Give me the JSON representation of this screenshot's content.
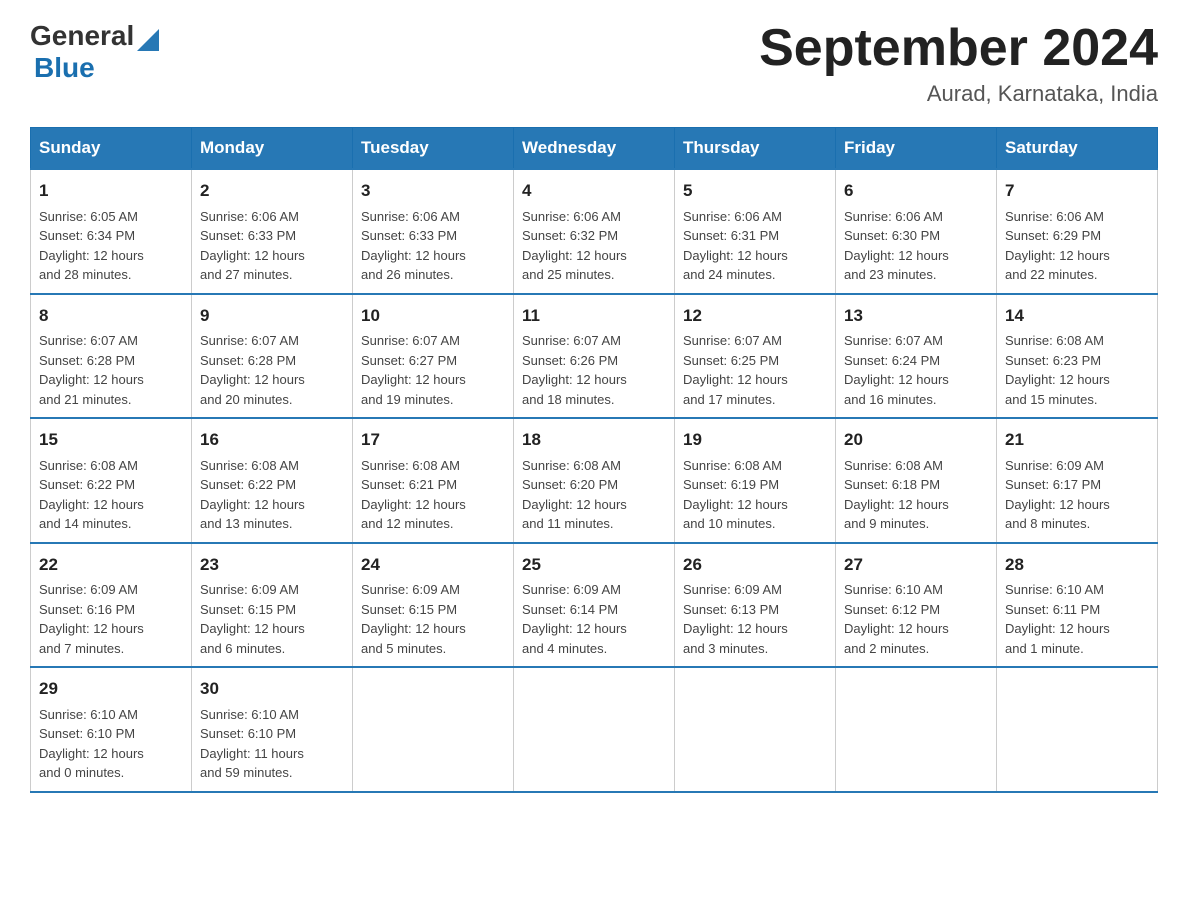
{
  "header": {
    "logo_general": "General",
    "logo_blue": "Blue",
    "month_title": "September 2024",
    "location": "Aurad, Karnataka, India"
  },
  "weekdays": [
    "Sunday",
    "Monday",
    "Tuesday",
    "Wednesday",
    "Thursday",
    "Friday",
    "Saturday"
  ],
  "weeks": [
    [
      {
        "day": "1",
        "sunrise": "6:05 AM",
        "sunset": "6:34 PM",
        "daylight": "12 hours and 28 minutes."
      },
      {
        "day": "2",
        "sunrise": "6:06 AM",
        "sunset": "6:33 PM",
        "daylight": "12 hours and 27 minutes."
      },
      {
        "day": "3",
        "sunrise": "6:06 AM",
        "sunset": "6:33 PM",
        "daylight": "12 hours and 26 minutes."
      },
      {
        "day": "4",
        "sunrise": "6:06 AM",
        "sunset": "6:32 PM",
        "daylight": "12 hours and 25 minutes."
      },
      {
        "day": "5",
        "sunrise": "6:06 AM",
        "sunset": "6:31 PM",
        "daylight": "12 hours and 24 minutes."
      },
      {
        "day": "6",
        "sunrise": "6:06 AM",
        "sunset": "6:30 PM",
        "daylight": "12 hours and 23 minutes."
      },
      {
        "day": "7",
        "sunrise": "6:06 AM",
        "sunset": "6:29 PM",
        "daylight": "12 hours and 22 minutes."
      }
    ],
    [
      {
        "day": "8",
        "sunrise": "6:07 AM",
        "sunset": "6:28 PM",
        "daylight": "12 hours and 21 minutes."
      },
      {
        "day": "9",
        "sunrise": "6:07 AM",
        "sunset": "6:28 PM",
        "daylight": "12 hours and 20 minutes."
      },
      {
        "day": "10",
        "sunrise": "6:07 AM",
        "sunset": "6:27 PM",
        "daylight": "12 hours and 19 minutes."
      },
      {
        "day": "11",
        "sunrise": "6:07 AM",
        "sunset": "6:26 PM",
        "daylight": "12 hours and 18 minutes."
      },
      {
        "day": "12",
        "sunrise": "6:07 AM",
        "sunset": "6:25 PM",
        "daylight": "12 hours and 17 minutes."
      },
      {
        "day": "13",
        "sunrise": "6:07 AM",
        "sunset": "6:24 PM",
        "daylight": "12 hours and 16 minutes."
      },
      {
        "day": "14",
        "sunrise": "6:08 AM",
        "sunset": "6:23 PM",
        "daylight": "12 hours and 15 minutes."
      }
    ],
    [
      {
        "day": "15",
        "sunrise": "6:08 AM",
        "sunset": "6:22 PM",
        "daylight": "12 hours and 14 minutes."
      },
      {
        "day": "16",
        "sunrise": "6:08 AM",
        "sunset": "6:22 PM",
        "daylight": "12 hours and 13 minutes."
      },
      {
        "day": "17",
        "sunrise": "6:08 AM",
        "sunset": "6:21 PM",
        "daylight": "12 hours and 12 minutes."
      },
      {
        "day": "18",
        "sunrise": "6:08 AM",
        "sunset": "6:20 PM",
        "daylight": "12 hours and 11 minutes."
      },
      {
        "day": "19",
        "sunrise": "6:08 AM",
        "sunset": "6:19 PM",
        "daylight": "12 hours and 10 minutes."
      },
      {
        "day": "20",
        "sunrise": "6:08 AM",
        "sunset": "6:18 PM",
        "daylight": "12 hours and 9 minutes."
      },
      {
        "day": "21",
        "sunrise": "6:09 AM",
        "sunset": "6:17 PM",
        "daylight": "12 hours and 8 minutes."
      }
    ],
    [
      {
        "day": "22",
        "sunrise": "6:09 AM",
        "sunset": "6:16 PM",
        "daylight": "12 hours and 7 minutes."
      },
      {
        "day": "23",
        "sunrise": "6:09 AM",
        "sunset": "6:15 PM",
        "daylight": "12 hours and 6 minutes."
      },
      {
        "day": "24",
        "sunrise": "6:09 AM",
        "sunset": "6:15 PM",
        "daylight": "12 hours and 5 minutes."
      },
      {
        "day": "25",
        "sunrise": "6:09 AM",
        "sunset": "6:14 PM",
        "daylight": "12 hours and 4 minutes."
      },
      {
        "day": "26",
        "sunrise": "6:09 AM",
        "sunset": "6:13 PM",
        "daylight": "12 hours and 3 minutes."
      },
      {
        "day": "27",
        "sunrise": "6:10 AM",
        "sunset": "6:12 PM",
        "daylight": "12 hours and 2 minutes."
      },
      {
        "day": "28",
        "sunrise": "6:10 AM",
        "sunset": "6:11 PM",
        "daylight": "12 hours and 1 minute."
      }
    ],
    [
      {
        "day": "29",
        "sunrise": "6:10 AM",
        "sunset": "6:10 PM",
        "daylight": "12 hours and 0 minutes."
      },
      {
        "day": "30",
        "sunrise": "6:10 AM",
        "sunset": "6:10 PM",
        "daylight": "11 hours and 59 minutes."
      },
      null,
      null,
      null,
      null,
      null
    ]
  ],
  "labels": {
    "sunrise": "Sunrise:",
    "sunset": "Sunset:",
    "daylight": "Daylight:"
  }
}
